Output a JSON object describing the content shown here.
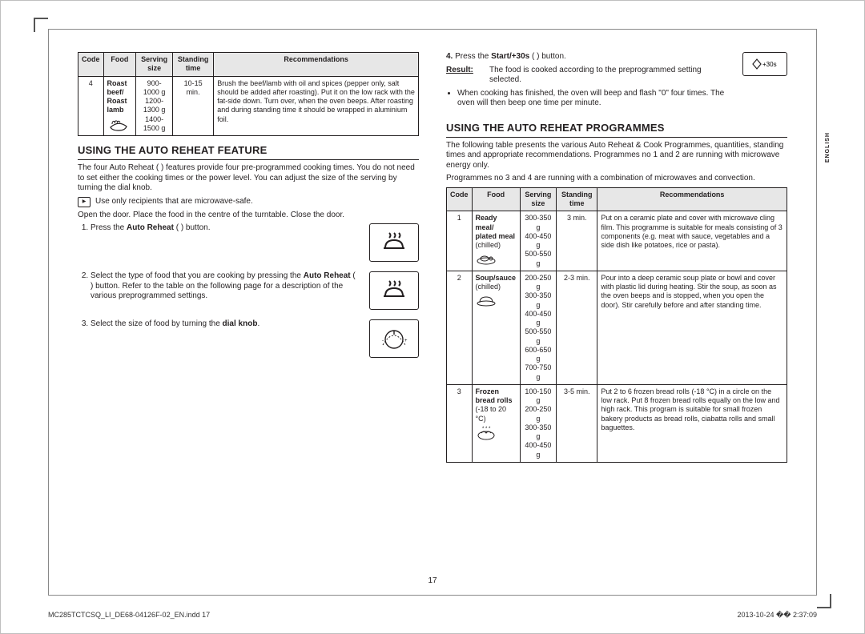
{
  "pageNumber": "17",
  "language_tab": "ENGLISH",
  "footer": {
    "left": "MC285TCTCSQ_LI_DE68-04126F-02_EN.indd   17",
    "right": "2013-10-24   �� 2:37:09"
  },
  "tableA": {
    "headers": {
      "code": "Code",
      "food": "Food",
      "serving": "Serving size",
      "stand": "Standing time",
      "rec": "Recommendations"
    },
    "row": {
      "code": "4",
      "food_l1": "Roast beef/",
      "food_l2": "Roast lamb",
      "serv_l1": "900-1000 g",
      "serv_l2": "1200-1300 g",
      "serv_l3": "1400-1500 g",
      "stand_l1": "10-15",
      "stand_l2": "min.",
      "rec": "Brush the beef/lamb with oil and spices (pepper only, salt should be added after roasting). Put it on the low rack with the fat-side down. Turn over, when the oven beeps. After roasting and during standing time it should be wrapped in aluminium foil."
    }
  },
  "secA": {
    "title": "USING THE AUTO REHEAT FEATURE",
    "intro": "The four Auto Reheat (      ) features provide four pre-programmed cooking times. You do not need to set either the cooking times or the power level. You can adjust the size of the serving by turning the dial knob.",
    "note": "Use only recipients that are microwave-safe.",
    "open_line": "Open the door. Place the food in the centre of the turntable. Close the door.",
    "steps": {
      "s1_a": "Press the ",
      "s1_b": "Auto Reheat",
      "s1_c": " (      ) button.",
      "s2_a": "Select the type of food that you are cooking by pressing the ",
      "s2_b": "Auto Reheat",
      "s2_c": " (      ) button. Refer to the table on the following page for a description of the various preprogrammed settings.",
      "s3_a": "Select the size of food by turning the ",
      "s3_b": "dial knob",
      "s3_c": "."
    }
  },
  "rightTop": {
    "s4_a": "Press the ",
    "s4_b": "Start/+30s",
    "s4_c": " (       ) button.",
    "icon_label": "+30s",
    "result_label": "Result:",
    "result_text": "The food is cooked according to the preprogrammed setting selected.",
    "bullet": "When cooking has finished, the oven will beep and flash \"0\" four times. The oven will then beep one time per minute."
  },
  "secB": {
    "title": "USING THE AUTO REHEAT PROGRAMMES",
    "p1": "The following table presents the various Auto Reheat & Cook Programmes, quantities, standing times and appropriate recommendations. Programmes no 1 and 2 are running with microwave energy only.",
    "p2": "Programmes no 3 and 4 are running with a combination of microwaves and convection."
  },
  "tableB": {
    "headers": {
      "code": "Code",
      "food": "Food",
      "serving": "Serving size",
      "stand": "Standing time",
      "rec": "Recommendations"
    },
    "rows": [
      {
        "code": "1",
        "food_l1": "Ready meal/",
        "food_l2": "plated meal",
        "food_l3": "(chilled)",
        "serv": [
          "300-350 g",
          "400-450 g",
          "500-550 g"
        ],
        "stand": "3 min.",
        "rec": "Put on a ceramic plate and cover with microwave cling film. This programme is suitable for meals consisting of 3 components (e.g. meat with sauce, vegetables and a side dish like potatoes, rice or pasta)."
      },
      {
        "code": "2",
        "food_l1": "Soup/sauce",
        "food_l3": "(chilled)",
        "serv": [
          "200-250 g",
          "300-350 g",
          "400-450 g",
          "500-550 g",
          "600-650 g",
          "700-750 g"
        ],
        "stand": "2-3 min.",
        "rec": "Pour into a deep ceramic soup plate or bowl and cover with plastic lid during heating. Stir the soup, as soon as the oven beeps and is stopped, when you open the door). Stir carefully before and after standing time."
      },
      {
        "code": "3",
        "food_l1": "Frozen",
        "food_l2": "bread rolls",
        "food_l3": "(-18 to 20 °C)",
        "serv": [
          "100-150 g",
          "200-250 g",
          "300-350 g",
          "400-450 g"
        ],
        "stand": "3-5 min.",
        "rec": "Put 2 to 6 frozen bread rolls (-18 °C) in a circle on the low rack. Put 8 frozen bread rolls equally on the low and high rack. This program is suitable for small frozen bakery products as bread rolls, ciabatta rolls and small baguettes."
      }
    ]
  }
}
